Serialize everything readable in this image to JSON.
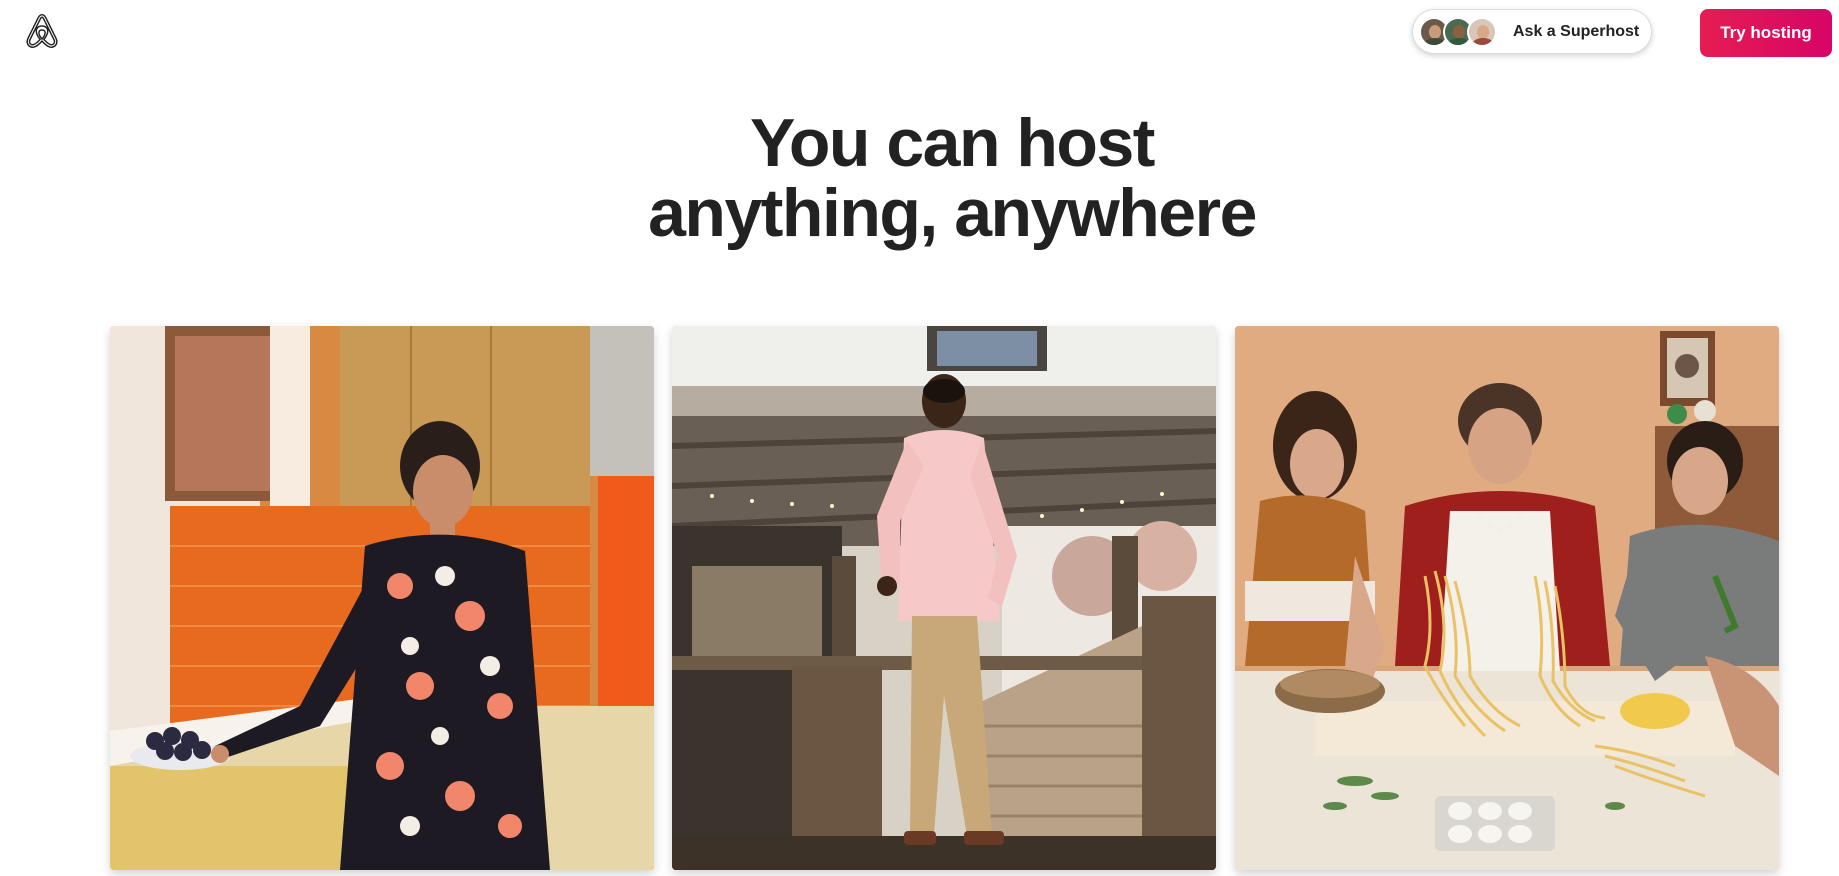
{
  "header": {
    "logo_icon": "airbnb-logo-icon",
    "superhost_button": {
      "label": "Ask a Superhost",
      "avatars": [
        "superhost-avatar-1",
        "superhost-avatar-2",
        "superhost-avatar-3"
      ]
    },
    "try_hosting_label": "Try hosting",
    "brand_color": "#e51d53"
  },
  "hero": {
    "title_line1": "You can host",
    "title_line2": "anything, anywhere"
  },
  "photos": [
    {
      "icon": "host-photo-kitchen-icon"
    },
    {
      "icon": "host-photo-treehouse-icon"
    },
    {
      "icon": "host-photo-pasta-icon"
    }
  ]
}
